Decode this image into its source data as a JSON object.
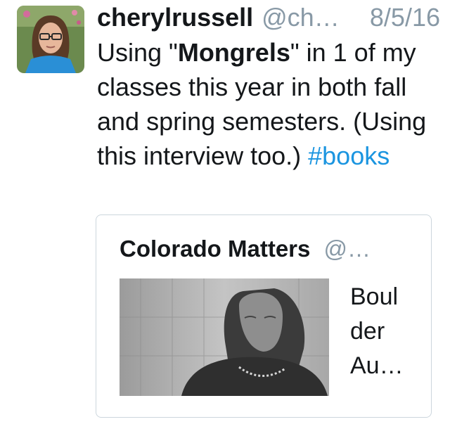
{
  "tweet": {
    "user_name": "cherylrussell",
    "handle": "@ch…",
    "date": "8/5/16",
    "text_before": "Using \"",
    "text_bold": "Mongrels",
    "text_after": "\" in 1 of my classes this year in both fall and spring semesters. (Using this interview too.) ",
    "hashtag": "#books",
    "avatar_icon": "user-avatar-photo"
  },
  "card": {
    "name": "Colorado Matters",
    "handle": "@…",
    "title_lines": [
      "Boul",
      "der",
      "Au…"
    ],
    "image_icon": "author-photo"
  },
  "colors": {
    "text": "#14171a",
    "muted": "#8899a6",
    "link": "#1b95e0",
    "border": "#ccd6dd"
  }
}
